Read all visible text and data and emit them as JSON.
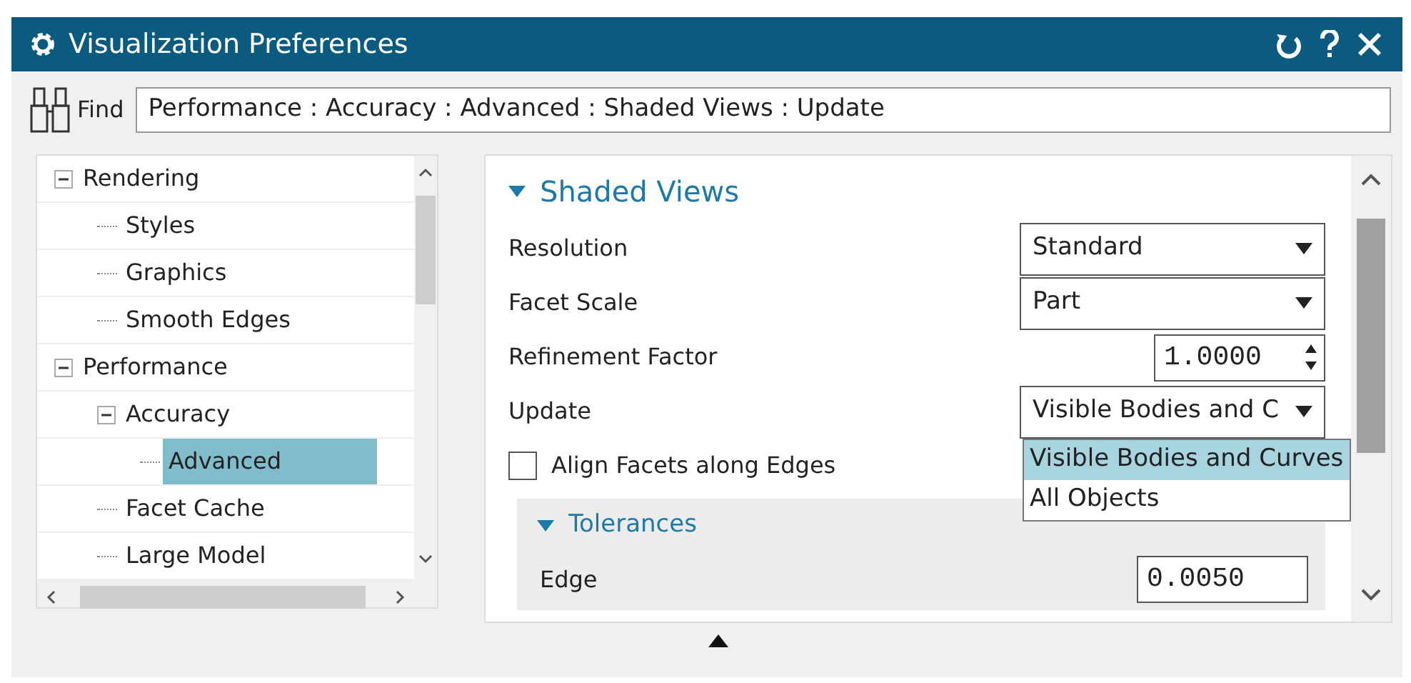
{
  "window": {
    "title": "Visualization Preferences"
  },
  "find": {
    "label": "Find",
    "value": "Performance : Accuracy : Advanced : Shaded Views : Update"
  },
  "tree": [
    {
      "label": "Rendering",
      "expanded": true,
      "selected": false,
      "children": [
        {
          "label": "Styles",
          "selected": false
        },
        {
          "label": "Graphics",
          "selected": false
        },
        {
          "label": "Smooth Edges",
          "selected": false
        }
      ]
    },
    {
      "label": "Performance",
      "expanded": true,
      "selected": false,
      "children": [
        {
          "label": "Accuracy",
          "expanded": true,
          "selected": false,
          "children": [
            {
              "label": "Advanced",
              "selected": true
            }
          ]
        },
        {
          "label": "Facet Cache",
          "selected": false
        },
        {
          "label": "Large Model",
          "selected": false
        }
      ]
    }
  ],
  "section": {
    "title": "Shaded Views",
    "expanded": true,
    "fields": [
      {
        "kind": "select",
        "label": "Resolution",
        "value": "Standard"
      },
      {
        "kind": "select",
        "label": "Facet Scale",
        "value": "Part"
      },
      {
        "kind": "spinner",
        "label": "Refinement Factor",
        "value": "1.0000"
      },
      {
        "kind": "select",
        "label": "Update",
        "value": "Visible Bodies and C",
        "open": true,
        "options": [
          {
            "label": "Visible Bodies and Curves",
            "selected": true
          },
          {
            "label": "All Objects",
            "selected": false
          }
        ]
      },
      {
        "kind": "checkbox",
        "label": "Align Facets along Edges",
        "checked": false
      }
    ],
    "subsection": {
      "title": "Tolerances",
      "expanded": true,
      "fields": [
        {
          "kind": "number",
          "label": "Edge",
          "value": "0.0050"
        }
      ]
    }
  }
}
